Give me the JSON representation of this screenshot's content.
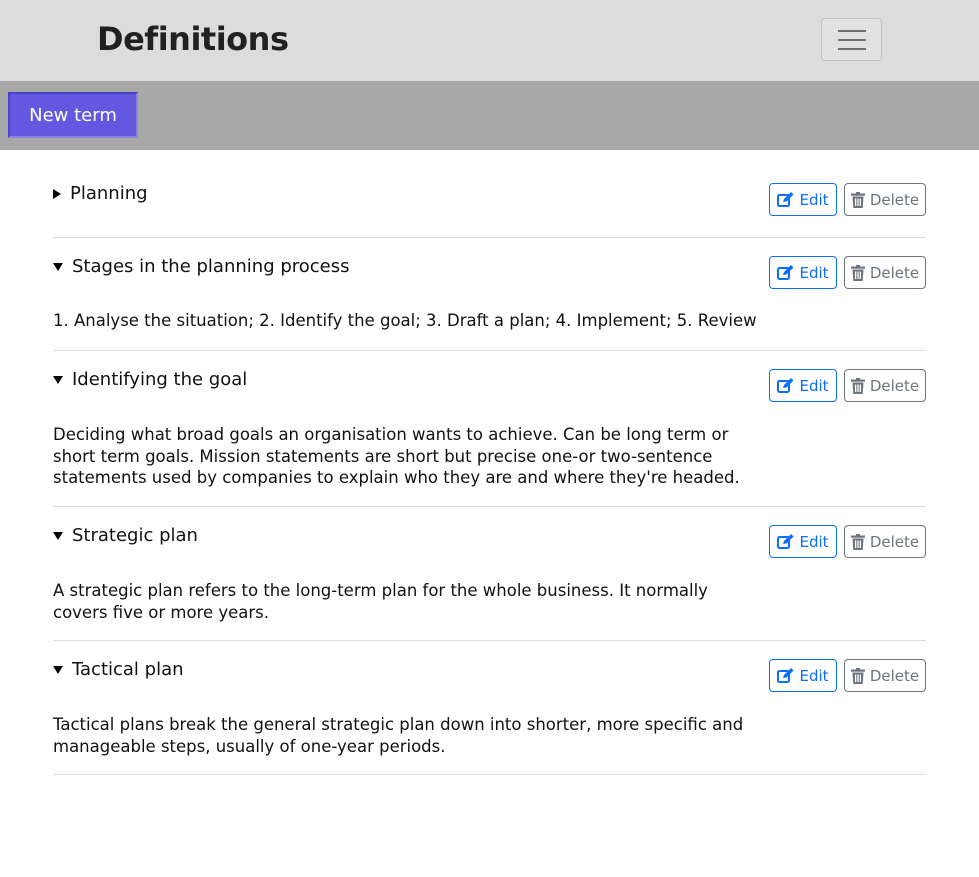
{
  "header": {
    "title": "Definitions",
    "menu_icon": "hamburger-icon"
  },
  "toolbar": {
    "new_term_label": "New term"
  },
  "actions": {
    "edit_label": "Edit",
    "delete_label": "Delete",
    "edit_icon": "edit-icon",
    "delete_icon": "trash-icon"
  },
  "colors": {
    "navbar_bg": "#dcdcdc",
    "toolbar_bg": "#a8a8a8",
    "primary_button": "#6358e0",
    "edit_blue": "#0d6efd",
    "delete_gray": "#6c757d"
  },
  "terms": [
    {
      "title": "Planning",
      "expanded": false,
      "definition": ""
    },
    {
      "title": "Stages in the planning process",
      "expanded": true,
      "definition": "1. Analyse the situation; 2. Identify the goal; 3. Draft a plan; 4. Implement; 5. Review"
    },
    {
      "title": "Identifying the goal",
      "expanded": true,
      "definition": "Deciding what broad goals an organisation wants to achieve. Can be long term or short term goals. Mission statements are short but precise one-or two-sentence statements used by companies to explain who they are and where they're headed."
    },
    {
      "title": "Strategic plan",
      "expanded": true,
      "definition": "A strategic plan refers to the long-term plan for the whole business. It normally covers five or more years."
    },
    {
      "title": "Tactical plan",
      "expanded": true,
      "definition": "Tactical plans break the general strategic plan down into shorter, more specific and manageable steps, usually of one-year periods."
    }
  ]
}
